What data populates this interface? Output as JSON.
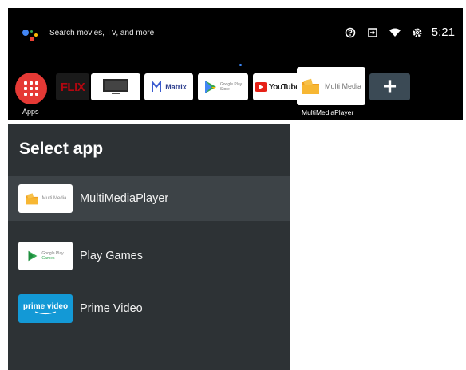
{
  "home": {
    "search_placeholder": "Search movies, TV, and more",
    "clock": "5:21",
    "apps_label": "Apps",
    "focused_app_label": "MultiMediaPlayer",
    "tiles": {
      "netflix_text": "FLIX",
      "matrix_text": "Matrix",
      "gplay_top": "Google Play",
      "gplay_bottom": "Store",
      "youtube_text": "YouTube",
      "mmp_text": "Multi Media",
      "plus": "+"
    }
  },
  "dialog": {
    "title": "Select app",
    "items": [
      {
        "label": "MultiMediaPlayer",
        "icon": "multimedia-icon",
        "icon_text": "Multi Media"
      },
      {
        "label": "Play Games",
        "icon": "play-games-icon",
        "icon_top": "Google Play",
        "icon_bottom": "Games"
      },
      {
        "label": "Prime Video",
        "icon": "prime-video-icon",
        "icon_text": "prime video"
      }
    ]
  },
  "colors": {
    "apps_red": "#e53935",
    "dialog_bg": "#2d3235",
    "selected_row": "#3d4347",
    "prime_blue": "#1399d6"
  }
}
